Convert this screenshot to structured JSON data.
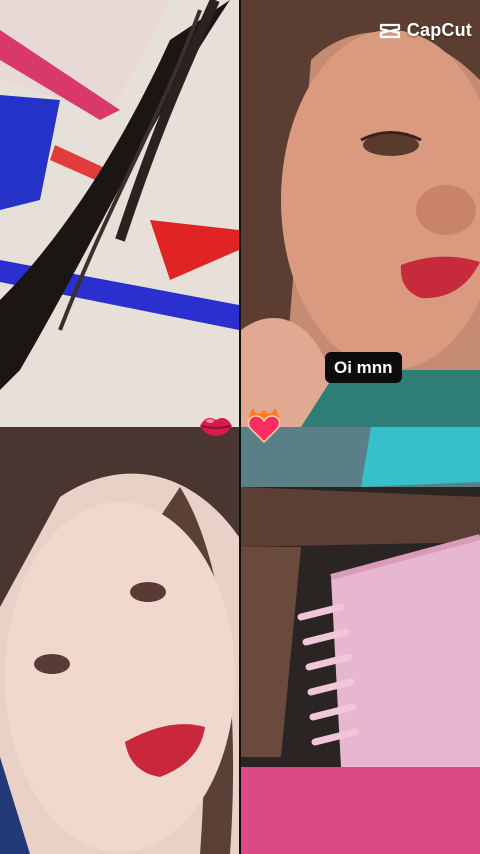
{
  "brand": {
    "name": "CapCut",
    "logo_icon": "capcut-logo-icon"
  },
  "caption": {
    "text": "Oi mnn"
  },
  "stickers": [
    {
      "name": "kiss-lips-icon",
      "glyph": "lips"
    },
    {
      "name": "heart-on-fire-icon",
      "glyph": "flaming heart"
    }
  ],
  "tiles": [
    {
      "name": "video-tile-top-left"
    },
    {
      "name": "video-tile-top-right"
    },
    {
      "name": "video-tile-bottom-left"
    },
    {
      "name": "video-tile-bottom-right"
    }
  ],
  "colors": {
    "lips": "#c62a3b",
    "caption_bg": "#0c0c0c",
    "text": "#ffffff"
  }
}
